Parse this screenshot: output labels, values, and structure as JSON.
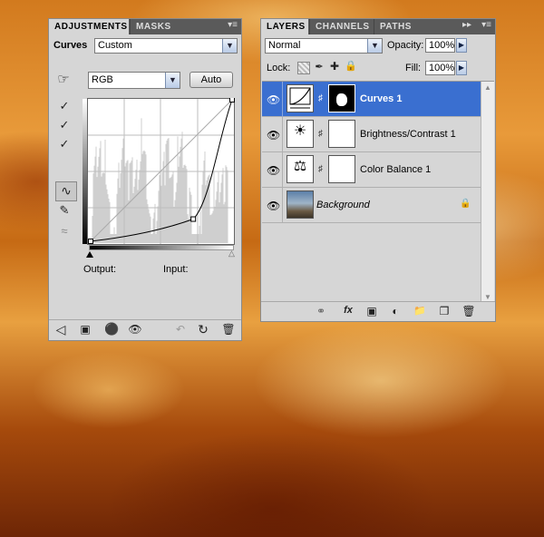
{
  "adjustments": {
    "tabs": [
      "ADJUSTMENTS",
      "MASKS"
    ],
    "menu_icon": "▾≡",
    "adj_label": "Curves",
    "preset_value": "Custom",
    "channel_value": "RGB",
    "auto_label": "Auto",
    "output_label": "Output:",
    "input_label": "Input:"
  },
  "layers_panel": {
    "tabs": [
      "LAYERS",
      "CHANNELS",
      "PATHS"
    ],
    "more_icon": "▸▸",
    "menu_icon": "▾≡",
    "blend_mode": "Normal",
    "opacity_label": "Opacity:",
    "opacity_value": "100%",
    "lock_label": "Lock:",
    "fill_label": "Fill:",
    "fill_value": "100%",
    "layers": [
      {
        "name": "Curves 1",
        "selected": true
      },
      {
        "name": "Brightness/Contrast 1",
        "selected": false
      },
      {
        "name": "Color Balance 1",
        "selected": false
      },
      {
        "name": "Background",
        "selected": false
      }
    ]
  },
  "curve": {
    "points": [
      [
        0,
        0
      ],
      [
        185,
        40
      ],
      [
        255,
        255
      ]
    ]
  }
}
